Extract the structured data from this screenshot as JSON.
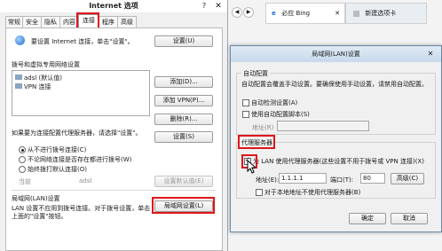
{
  "internet_options": {
    "title": "Internet 选项",
    "help": "?",
    "close": "✕",
    "tabs": [
      "常规",
      "安全",
      "隐私",
      "内容",
      "连接",
      "程序",
      "高级"
    ],
    "active_tab": 4,
    "setup_text": "要设置 Internet 连接，单击\"设置\"。",
    "setup_button": "设置(U)",
    "dialup_section": "拨号和虚拟专用网络设置",
    "connections": [
      "adsl (默认值)",
      "VPN 连接"
    ],
    "add_button": "添加(D)...",
    "add_vpn_button": "添加 VPN(P)...",
    "remove_button": "删除(R)...",
    "proxy_hint": "如果要为连接配置代理服务器，请选择\"设置\"。",
    "settings_button": "设置(S)",
    "radio_options": [
      "从不进行拨号连接(C)",
      "不论网络连接是否存在都进行拨号(W)",
      "始终拨打默认连接(O)"
    ],
    "radio_selected": 0,
    "current_label": "当前",
    "current_value": "adsl",
    "default_button": "设置默认值(E)",
    "lan_section": "局域网(LAN)设置",
    "lan_desc_1": "LAN 设置不应用到拨号连接。对于拨号设置，单击",
    "lan_desc_2": "上面的\"设置\"按钮。",
    "lan_button": "局域网设置(L)"
  },
  "browser": {
    "nav_back": "◀",
    "nav_forward": "▶",
    "tab1_icon": "e",
    "tab1_label": "必应 Bing",
    "tab1_close": "✕",
    "tab2_label": "新建选项卡"
  },
  "lan_dialog": {
    "title": "局域网(LAN)设置",
    "close": "✕",
    "auto_section": "自动配置",
    "auto_desc": "自动配置会覆盖手动设置。要确保使用手动设置，请禁用自动配置。",
    "auto_detect": "自动检测设置(A)",
    "use_script": "使用自动配置脚本(S)",
    "address_label": "地址(R)",
    "proxy_section": "代理服务器",
    "use_proxy": "为 LAN 使用代理服务器(这些设置不用于拨号或 VPN 连接)(X)",
    "addr_label": "地址(E):",
    "addr_value": "1.1.1.1",
    "port_label": "端口(T):",
    "port_value": "80",
    "advanced_button": "高级(C)",
    "bypass_local": "对于本地地址不使用代理服务器(B)",
    "ok_button": "确定",
    "cancel_button": "取消",
    "checks": {
      "auto_detect": false,
      "use_script": false,
      "use_proxy": true,
      "bypass_local": false
    }
  },
  "colors": {
    "highlight": "#e0151b",
    "title_gradient": "#c7d9ec"
  }
}
